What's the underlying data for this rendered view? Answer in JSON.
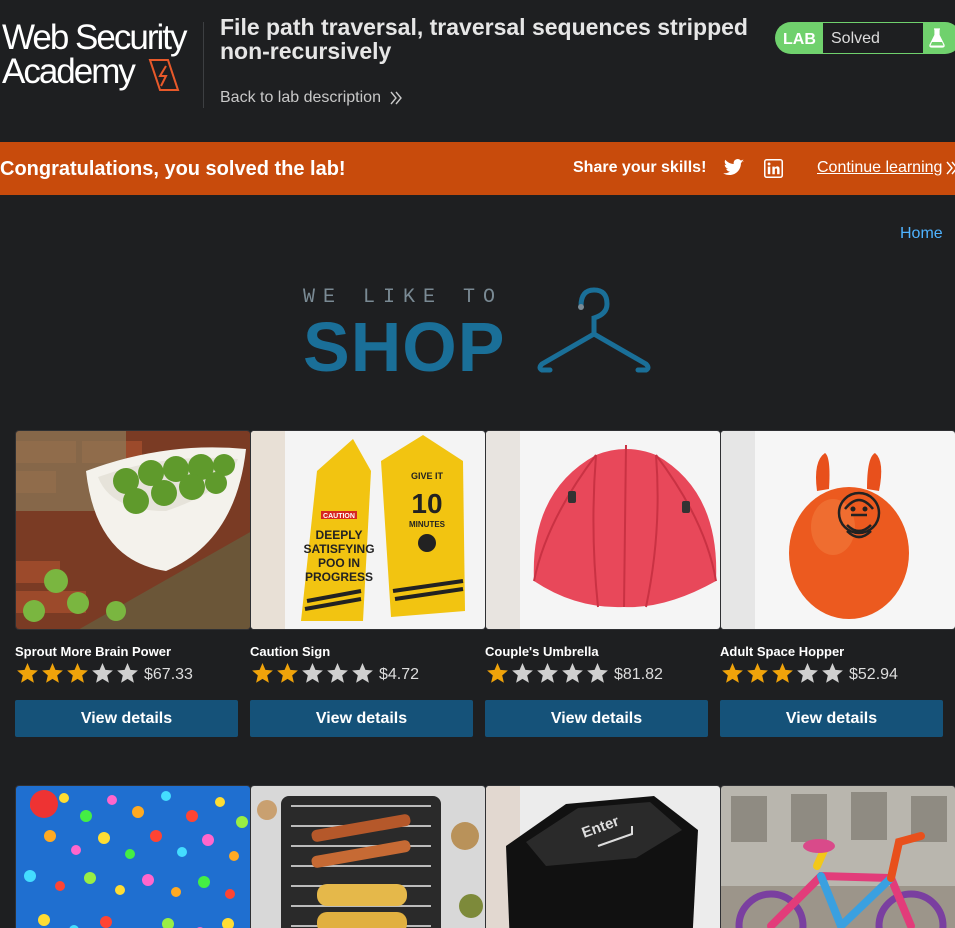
{
  "header": {
    "logo_line1": "Web Security",
    "logo_line2": "Academy",
    "lab_title": "File path traversal, traversal sequences stripped non-recursively",
    "back_link": "Back to lab description",
    "lab_tag": "LAB",
    "status": "Solved"
  },
  "banner": {
    "message": "Congratulations, you solved the lab!",
    "share_label": "Share your skills!",
    "continue_label": "Continue learning"
  },
  "nav": {
    "home": "Home"
  },
  "hero": {
    "tagline": "WE LIKE TO",
    "title": "SHOP"
  },
  "products": [
    {
      "name": "Sprout More Brain Power",
      "rating": 3,
      "price": "$67.33",
      "button": "View details"
    },
    {
      "name": "Caution Sign",
      "rating": 2,
      "price": "$4.72",
      "button": "View details"
    },
    {
      "name": "Couple's Umbrella",
      "rating": 1,
      "price": "$81.82",
      "button": "View details"
    },
    {
      "name": "Adult Space Hopper",
      "rating": 3,
      "price": "$52.94",
      "button": "View details"
    }
  ],
  "colors": {
    "accent_orange": "#c84b0c",
    "status_green": "#70d16d",
    "button_blue": "#155279",
    "link_blue": "#4fb3ff",
    "star_filled": "#f0a30a",
    "star_empty": "#d0d0d0"
  }
}
